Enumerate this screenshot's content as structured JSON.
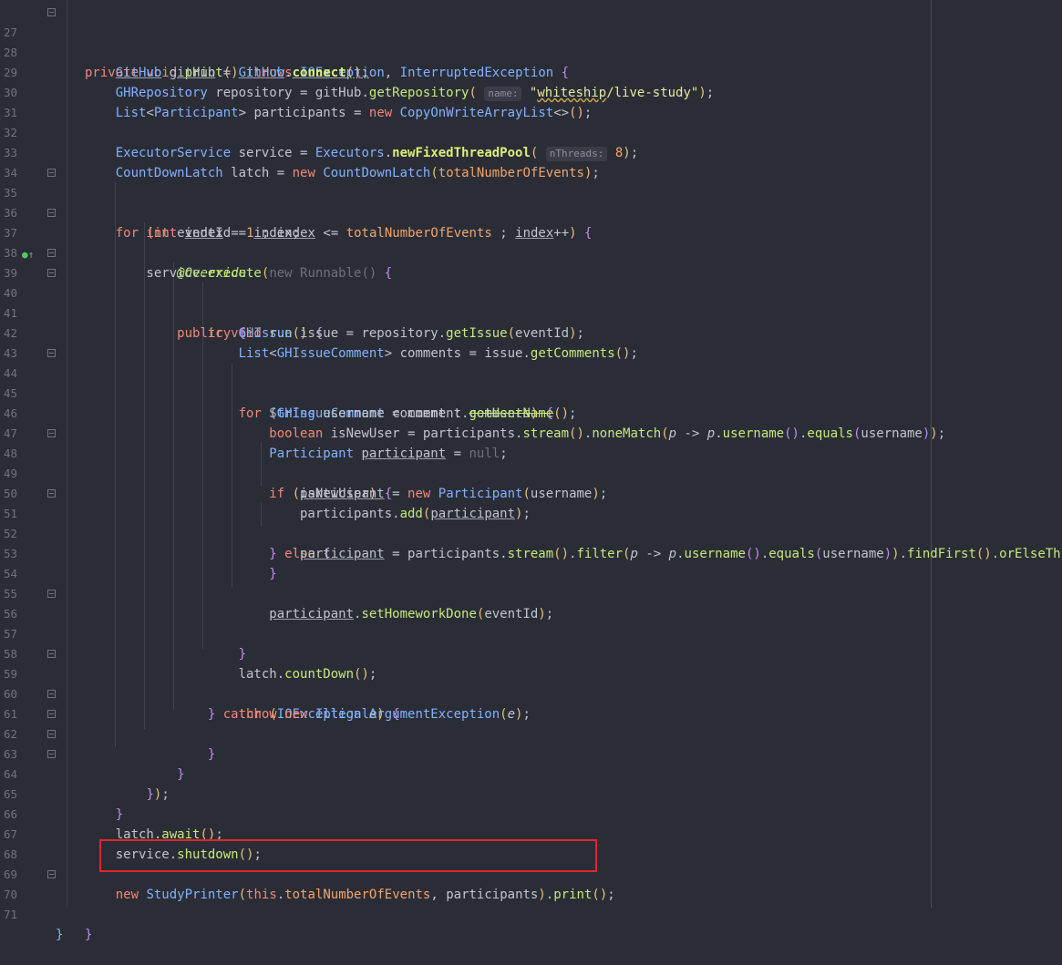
{
  "editor": {
    "line_numbers": [
      "27",
      "28",
      "29",
      "30",
      "31",
      "32",
      "33",
      "34",
      "35",
      "36",
      "37",
      "38",
      "39",
      "40",
      "41",
      "42",
      "43",
      "44",
      "45",
      "46",
      "47",
      "48",
      "49",
      "50",
      "51",
      "52",
      "53",
      "54",
      "55",
      "56",
      "57",
      "58",
      "59",
      "60",
      "61",
      "62",
      "63",
      "64",
      "65",
      "66",
      "67",
      "68",
      "69",
      "70",
      "71"
    ],
    "hints": {
      "name": "name:",
      "nThreads": "nThreads:"
    },
    "highlight_line": "69",
    "colors": {
      "background": "#2b2d36",
      "highlight_box": "#e0262b",
      "keyword": "#f28779",
      "type": "#82b1ff",
      "method": "#c6e87a"
    }
  }
}
